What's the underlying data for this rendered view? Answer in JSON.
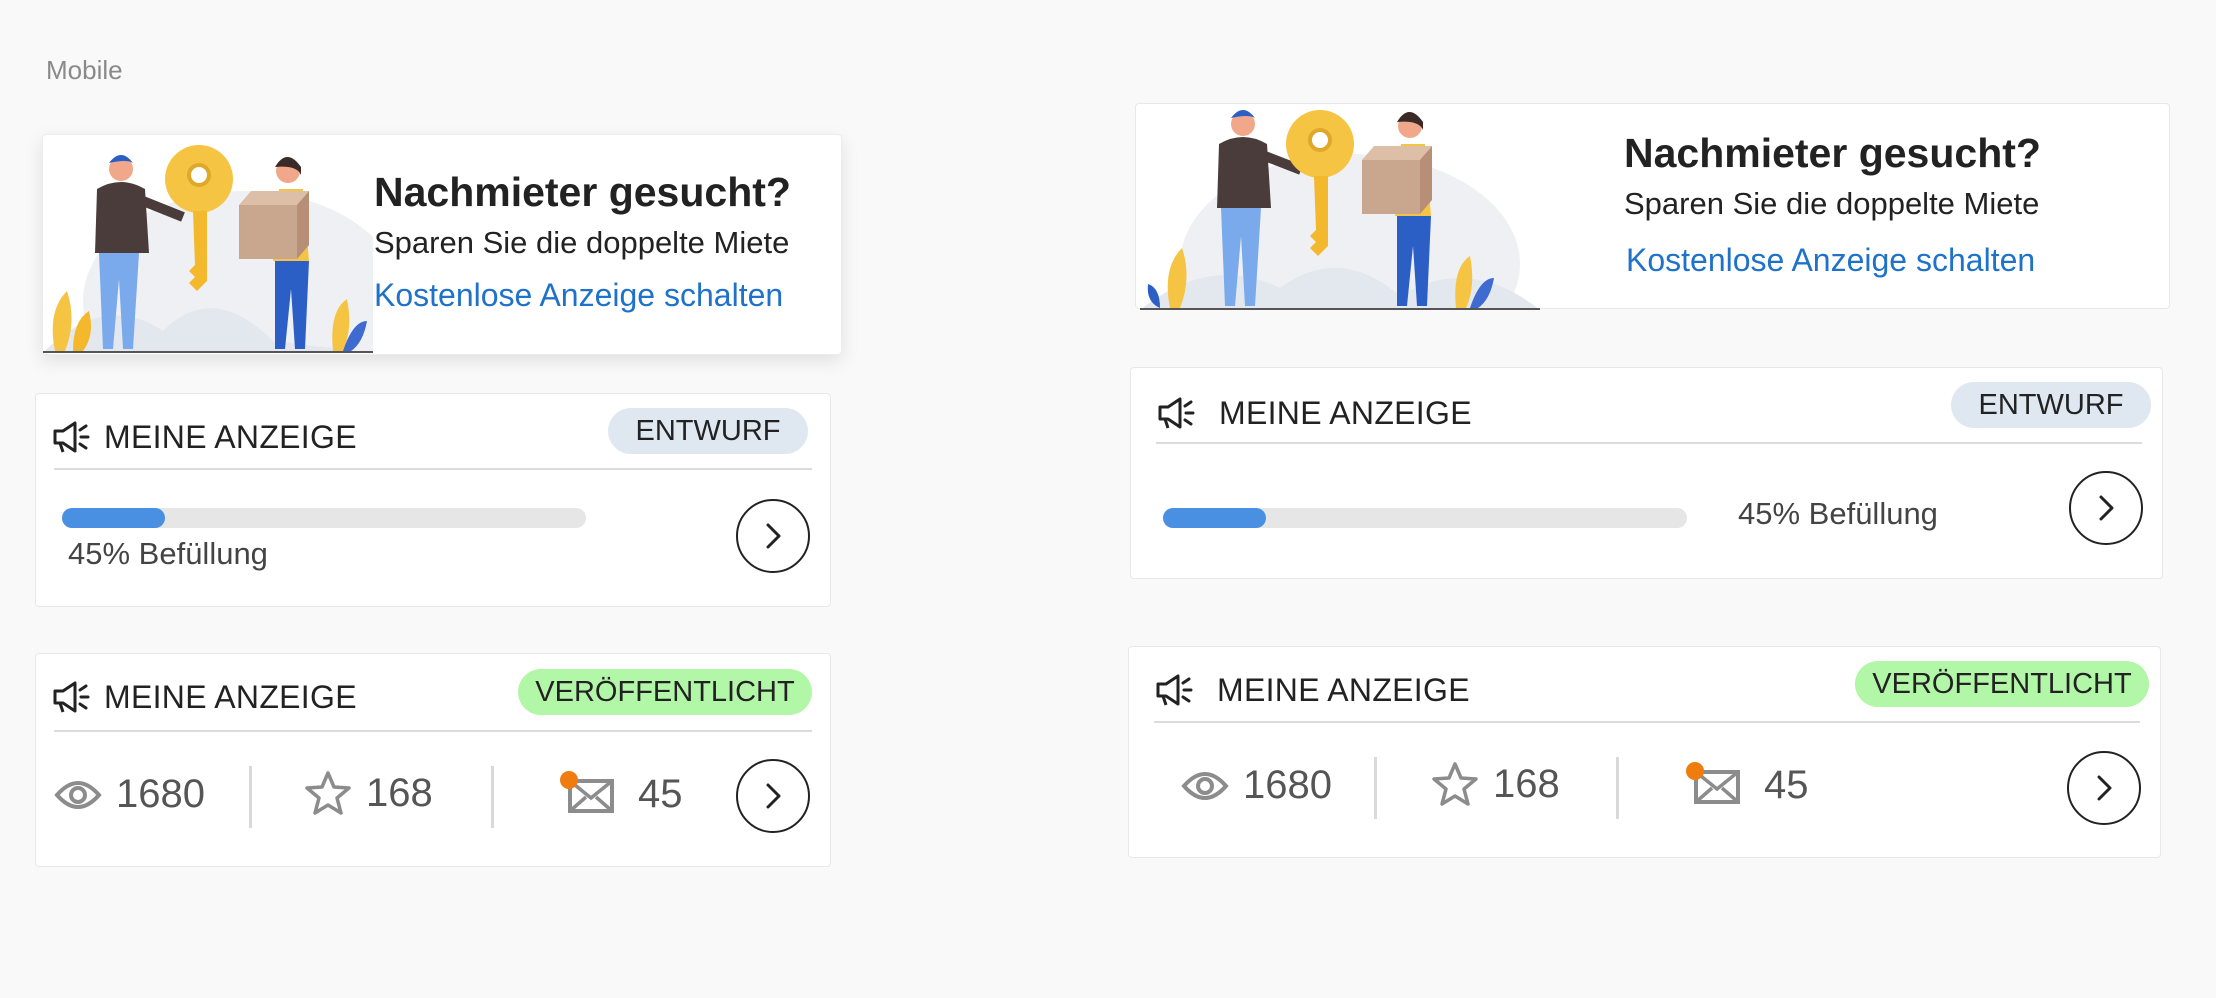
{
  "section_label": "Mobile",
  "colors": {
    "link": "#1f72c9",
    "progress": "#4a90e2",
    "draft_badge": "#dfe7f1",
    "published_badge": "#b2f6a7",
    "notification_dot": "#f07c0f"
  },
  "promo": {
    "title": "Nachmieter gesucht?",
    "subtitle": "Sparen Sie die doppelte Miete",
    "link": "Kostenlose Anzeige schalten"
  },
  "draft_card": {
    "title": "MEINE ANZEIGE",
    "icon": "megaphone-icon",
    "badge": "ENTWURF",
    "progress_fraction": 0.45,
    "progress_text": "45% Befüllung"
  },
  "published_card": {
    "title": "MEINE ANZEIGE",
    "icon": "megaphone-icon",
    "badge": "VERÖFFENTLICHT",
    "stats": {
      "views": "1680",
      "favorites": "168",
      "messages": "45"
    },
    "stat_icons": [
      "eye-icon",
      "star-icon",
      "envelope-icon"
    ]
  }
}
